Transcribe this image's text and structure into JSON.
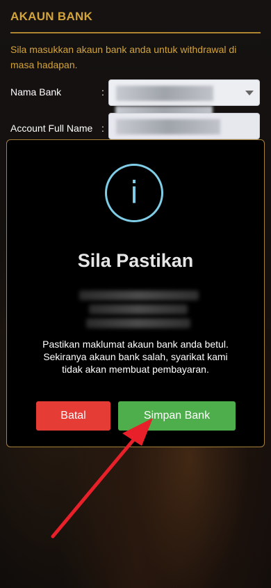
{
  "section": {
    "title": "AKAUN BANK",
    "intro": "Sila masukkan akaun bank anda untuk withdrawal di masa hadapan."
  },
  "form": {
    "bank_label": "Nama Bank",
    "name_label": "Account Full Name",
    "colon": ":"
  },
  "modal": {
    "icon": "info-icon",
    "icon_glyph": "i",
    "title": "Sila Pastikan",
    "message": "Pastikan maklumat akaun bank anda betul. Sekiranya akaun bank salah, syarikat kami tidak akan membuat pembayaran.",
    "cancel_label": "Batal",
    "save_label": "Simpan Bank"
  },
  "colors": {
    "accent_gold": "#d4a43c",
    "info_blue": "#7fcde6",
    "cancel_red": "#e53c36",
    "save_green": "#4fae4c",
    "annotation_arrow": "#e8202a"
  }
}
